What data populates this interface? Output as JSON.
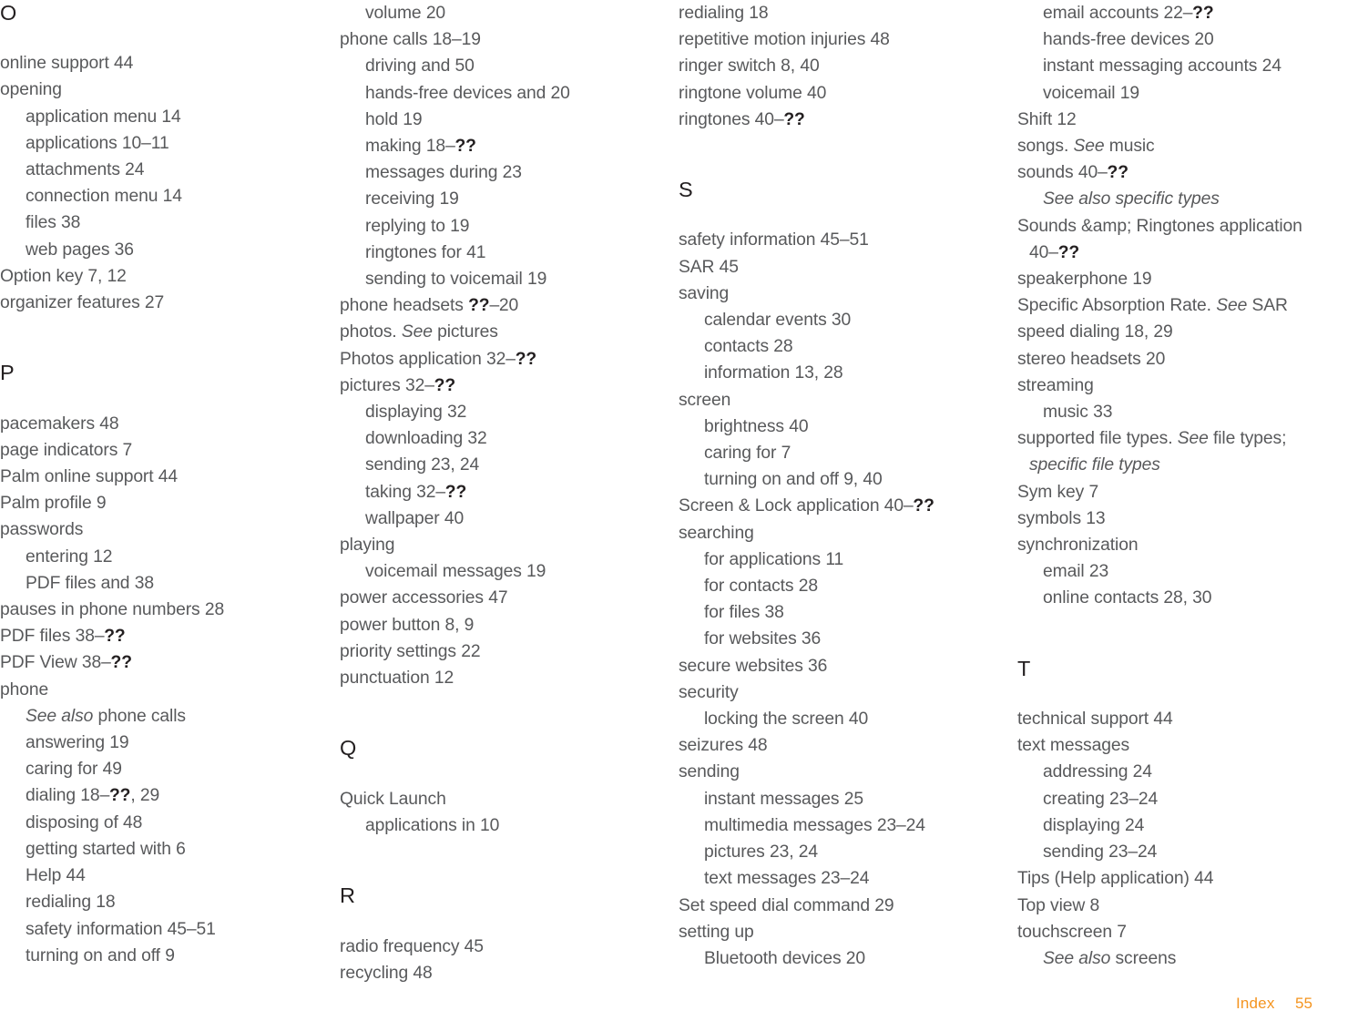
{
  "page": {
    "type": "index",
    "footer": {
      "label": "Index",
      "page_number": "55"
    },
    "colors": {
      "body_text": "#58595b",
      "heading_text": "#231f20",
      "footer_accent": "#f4941f",
      "background": "#ffffff"
    },
    "unresolved_reference_marker": "??"
  },
  "columns": [
    {
      "name": "column-1",
      "lines": [
        {
          "kind": "letter",
          "text": "O"
        },
        {
          "kind": "gap"
        },
        {
          "kind": "entry",
          "level": 1,
          "text": "online support 44"
        },
        {
          "kind": "entry",
          "level": 1,
          "text": "opening"
        },
        {
          "kind": "entry",
          "level": 2,
          "text": "application menu 14"
        },
        {
          "kind": "entry",
          "level": 2,
          "text": "applications 10–11"
        },
        {
          "kind": "entry",
          "level": 2,
          "text": "attachments 24"
        },
        {
          "kind": "entry",
          "level": 2,
          "text": "connection menu 14"
        },
        {
          "kind": "entry",
          "level": 2,
          "text": "files 38"
        },
        {
          "kind": "entry",
          "level": 2,
          "text": "web pages 36"
        },
        {
          "kind": "entry",
          "level": 1,
          "text": "Option key 7, 12"
        },
        {
          "kind": "entry",
          "level": 1,
          "text": "organizer features 27"
        },
        {
          "kind": "blank"
        },
        {
          "kind": "letter",
          "text": "P"
        },
        {
          "kind": "gap"
        },
        {
          "kind": "entry",
          "level": 1,
          "text": "pacemakers 48"
        },
        {
          "kind": "entry",
          "level": 1,
          "text": "page indicators 7"
        },
        {
          "kind": "entry",
          "level": 1,
          "text": "Palm online support 44"
        },
        {
          "kind": "entry",
          "level": 1,
          "text": "Palm profile 9"
        },
        {
          "kind": "entry",
          "level": 1,
          "text": "passwords"
        },
        {
          "kind": "entry",
          "level": 2,
          "text": "entering 12"
        },
        {
          "kind": "entry",
          "level": 2,
          "text": "PDF files and 38"
        },
        {
          "kind": "entry",
          "level": 1,
          "text": "pauses in phone numbers 28"
        },
        {
          "kind": "entry",
          "level": 1,
          "html": "PDF files 38<span class=\"endash\">–</span><span class=\"unresolved\">??</span>"
        },
        {
          "kind": "entry",
          "level": 1,
          "html": "PDF View 38<span class=\"endash\">–</span><span class=\"unresolved\">??</span>"
        },
        {
          "kind": "entry",
          "level": 1,
          "text": "phone"
        },
        {
          "kind": "entry",
          "level": 2,
          "html": "<span class=\"ital\">See also</span> phone calls"
        },
        {
          "kind": "entry",
          "level": 2,
          "text": "answering 19"
        },
        {
          "kind": "entry",
          "level": 2,
          "text": "caring for 49"
        },
        {
          "kind": "entry",
          "level": 2,
          "html": "dialing 18<span class=\"endash\">–</span><span class=\"unresolved\">??</span>, 29"
        },
        {
          "kind": "entry",
          "level": 2,
          "text": "disposing of 48"
        },
        {
          "kind": "entry",
          "level": 2,
          "text": "getting started with 6"
        },
        {
          "kind": "entry",
          "level": 2,
          "text": "Help 44"
        },
        {
          "kind": "entry",
          "level": 2,
          "text": "redialing 18"
        },
        {
          "kind": "entry",
          "level": 2,
          "text": "safety information 45–51"
        },
        {
          "kind": "entry",
          "level": 2,
          "text": "turning on and off 9"
        }
      ]
    },
    {
      "name": "column-2",
      "lines": [
        {
          "kind": "entry",
          "level": 2,
          "text": "volume 20"
        },
        {
          "kind": "entry",
          "level": 1,
          "text": "phone calls 18–19"
        },
        {
          "kind": "entry",
          "level": 2,
          "text": "driving and 50"
        },
        {
          "kind": "entry",
          "level": 2,
          "text": "hands-free devices and 20"
        },
        {
          "kind": "entry",
          "level": 2,
          "text": "hold 19"
        },
        {
          "kind": "entry",
          "level": 2,
          "html": "making 18<span class=\"endash\">–</span><span class=\"unresolved\">??</span>"
        },
        {
          "kind": "entry",
          "level": 2,
          "text": "messages during 23"
        },
        {
          "kind": "entry",
          "level": 2,
          "text": "receiving 19"
        },
        {
          "kind": "entry",
          "level": 2,
          "text": "replying to 19"
        },
        {
          "kind": "entry",
          "level": 2,
          "text": "ringtones for 41"
        },
        {
          "kind": "entry",
          "level": 2,
          "text": "sending to voicemail 19"
        },
        {
          "kind": "entry",
          "level": 1,
          "html": "phone headsets <span class=\"unresolved\">??</span><span class=\"endash\">–</span>20"
        },
        {
          "kind": "entry",
          "level": 1,
          "html": "photos. <span class=\"ital\">See</span> pictures"
        },
        {
          "kind": "entry",
          "level": 1,
          "html": "Photos application 32<span class=\"endash\">–</span><span class=\"unresolved\">??</span>"
        },
        {
          "kind": "entry",
          "level": 1,
          "html": "pictures 32<span class=\"endash\">–</span><span class=\"unresolved\">??</span>"
        },
        {
          "kind": "entry",
          "level": 2,
          "text": "displaying 32"
        },
        {
          "kind": "entry",
          "level": 2,
          "text": "downloading 32"
        },
        {
          "kind": "entry",
          "level": 2,
          "text": "sending 23, 24"
        },
        {
          "kind": "entry",
          "level": 2,
          "html": "taking 32<span class=\"endash\">–</span><span class=\"unresolved\">??</span>"
        },
        {
          "kind": "entry",
          "level": 2,
          "text": "wallpaper 40"
        },
        {
          "kind": "entry",
          "level": 1,
          "text": "playing"
        },
        {
          "kind": "entry",
          "level": 2,
          "text": "voicemail messages 19"
        },
        {
          "kind": "entry",
          "level": 1,
          "text": "power accessories 47"
        },
        {
          "kind": "entry",
          "level": 1,
          "text": "power button 8, 9"
        },
        {
          "kind": "entry",
          "level": 1,
          "text": "priority settings 22"
        },
        {
          "kind": "entry",
          "level": 1,
          "text": "punctuation 12"
        },
        {
          "kind": "blank"
        },
        {
          "kind": "letter",
          "text": "Q"
        },
        {
          "kind": "gap"
        },
        {
          "kind": "entry",
          "level": 1,
          "text": "Quick Launch"
        },
        {
          "kind": "entry",
          "level": 2,
          "text": "applications in 10"
        },
        {
          "kind": "blank"
        },
        {
          "kind": "letter",
          "text": "R"
        },
        {
          "kind": "gap"
        },
        {
          "kind": "entry",
          "level": 1,
          "text": "radio frequency 45"
        },
        {
          "kind": "entry",
          "level": 1,
          "text": "recycling 48"
        }
      ]
    },
    {
      "name": "column-3",
      "lines": [
        {
          "kind": "entry",
          "level": 1,
          "text": "redialing 18"
        },
        {
          "kind": "entry",
          "level": 1,
          "text": "repetitive motion injuries 48"
        },
        {
          "kind": "entry",
          "level": 1,
          "text": "ringer switch 8, 40"
        },
        {
          "kind": "entry",
          "level": 1,
          "text": "ringtone volume 40"
        },
        {
          "kind": "entry",
          "level": 1,
          "html": "ringtones 40<span class=\"endash\">–</span><span class=\"unresolved\">??</span>"
        },
        {
          "kind": "blank"
        },
        {
          "kind": "letter",
          "text": "S"
        },
        {
          "kind": "gap"
        },
        {
          "kind": "entry",
          "level": 1,
          "text": "safety information 45–51"
        },
        {
          "kind": "entry",
          "level": 1,
          "text": "SAR 45"
        },
        {
          "kind": "entry",
          "level": 1,
          "text": "saving"
        },
        {
          "kind": "entry",
          "level": 2,
          "text": "calendar events 30"
        },
        {
          "kind": "entry",
          "level": 2,
          "text": "contacts 28"
        },
        {
          "kind": "entry",
          "level": 2,
          "text": "information 13, 28"
        },
        {
          "kind": "entry",
          "level": 1,
          "text": "screen"
        },
        {
          "kind": "entry",
          "level": 2,
          "text": "brightness 40"
        },
        {
          "kind": "entry",
          "level": 2,
          "text": "caring for 7"
        },
        {
          "kind": "entry",
          "level": 2,
          "text": "turning on and off 9, 40"
        },
        {
          "kind": "entry",
          "level": 1,
          "html": "Screen &amp; Lock application 40<span class=\"endash\">–</span><span class=\"unresolved\">??</span>"
        },
        {
          "kind": "entry",
          "level": 1,
          "text": "searching"
        },
        {
          "kind": "entry",
          "level": 2,
          "text": "for applications 11"
        },
        {
          "kind": "entry",
          "level": 2,
          "text": "for contacts 28"
        },
        {
          "kind": "entry",
          "level": 2,
          "text": "for files 38"
        },
        {
          "kind": "entry",
          "level": 2,
          "text": "for websites 36"
        },
        {
          "kind": "entry",
          "level": 1,
          "text": "secure websites 36"
        },
        {
          "kind": "entry",
          "level": 1,
          "text": "security"
        },
        {
          "kind": "entry",
          "level": 2,
          "text": "locking the screen 40"
        },
        {
          "kind": "entry",
          "level": 1,
          "text": "seizures 48"
        },
        {
          "kind": "entry",
          "level": 1,
          "text": "sending"
        },
        {
          "kind": "entry",
          "level": 2,
          "text": "instant messages 25"
        },
        {
          "kind": "entry",
          "level": 2,
          "text": "multimedia messages 23–24"
        },
        {
          "kind": "entry",
          "level": 2,
          "text": "pictures 23, 24"
        },
        {
          "kind": "entry",
          "level": 2,
          "text": "text messages 23–24"
        },
        {
          "kind": "entry",
          "level": 1,
          "text": "Set speed dial command 29"
        },
        {
          "kind": "entry",
          "level": 1,
          "text": "setting up"
        },
        {
          "kind": "entry",
          "level": 2,
          "text": "Bluetooth devices 20"
        }
      ]
    },
    {
      "name": "column-4",
      "lines": [
        {
          "kind": "entry",
          "level": 2,
          "html": "email accounts 22<span class=\"endash\">–</span><span class=\"unresolved\">??</span>"
        },
        {
          "kind": "entry",
          "level": 2,
          "text": "hands-free devices 20"
        },
        {
          "kind": "entry",
          "level": 2,
          "text": "instant messaging accounts 24"
        },
        {
          "kind": "entry",
          "level": 2,
          "text": "voicemail 19"
        },
        {
          "kind": "entry",
          "level": 1,
          "text": "Shift 12"
        },
        {
          "kind": "entry",
          "level": 1,
          "html": "songs. <span class=\"ital\">See</span> music"
        },
        {
          "kind": "entry",
          "level": 1,
          "html": "sounds 40<span class=\"endash\">–</span><span class=\"unresolved\">??</span>"
        },
        {
          "kind": "entry",
          "level": 2,
          "html": "<span class=\"ital\">See also specific types</span>"
        },
        {
          "kind": "entry",
          "level": 1,
          "text": "Sounds &amp; Ringtones application"
        },
        {
          "kind": "entry",
          "level": "cont",
          "html": "40<span class=\"endash\">–</span><span class=\"unresolved\">??</span>"
        },
        {
          "kind": "entry",
          "level": 1,
          "text": "speakerphone 19"
        },
        {
          "kind": "entry",
          "level": 1,
          "html": "Specific Absorption Rate. <span class=\"ital\">See</span> SAR"
        },
        {
          "kind": "entry",
          "level": 1,
          "text": "speed dialing 18, 29"
        },
        {
          "kind": "entry",
          "level": 1,
          "text": "stereo headsets 20"
        },
        {
          "kind": "entry",
          "level": 1,
          "text": "streaming"
        },
        {
          "kind": "entry",
          "level": 2,
          "text": "music 33"
        },
        {
          "kind": "entry",
          "level": 1,
          "html": "supported file types. <span class=\"ital\">See</span> file types;"
        },
        {
          "kind": "entry",
          "level": "cont",
          "html": "<span class=\"ital\">specific file types</span>"
        },
        {
          "kind": "entry",
          "level": 1,
          "text": "Sym key 7"
        },
        {
          "kind": "entry",
          "level": 1,
          "text": "symbols 13"
        },
        {
          "kind": "entry",
          "level": 1,
          "text": "synchronization"
        },
        {
          "kind": "entry",
          "level": 2,
          "text": "email 23"
        },
        {
          "kind": "entry",
          "level": 2,
          "text": "online contacts 28, 30"
        },
        {
          "kind": "blank"
        },
        {
          "kind": "letter",
          "text": "T"
        },
        {
          "kind": "gap"
        },
        {
          "kind": "entry",
          "level": 1,
          "text": "technical support 44"
        },
        {
          "kind": "entry",
          "level": 1,
          "text": "text messages"
        },
        {
          "kind": "entry",
          "level": 2,
          "text": "addressing 24"
        },
        {
          "kind": "entry",
          "level": 2,
          "text": "creating 23–24"
        },
        {
          "kind": "entry",
          "level": 2,
          "text": "displaying 24"
        },
        {
          "kind": "entry",
          "level": 2,
          "text": "sending 23–24"
        },
        {
          "kind": "entry",
          "level": 1,
          "text": "Tips (Help application) 44"
        },
        {
          "kind": "entry",
          "level": 1,
          "text": "Top view 8"
        },
        {
          "kind": "entry",
          "level": 1,
          "text": "touchscreen 7"
        },
        {
          "kind": "entry",
          "level": 2,
          "html": "<span class=\"ital\">See also</span> screens"
        }
      ]
    }
  ]
}
